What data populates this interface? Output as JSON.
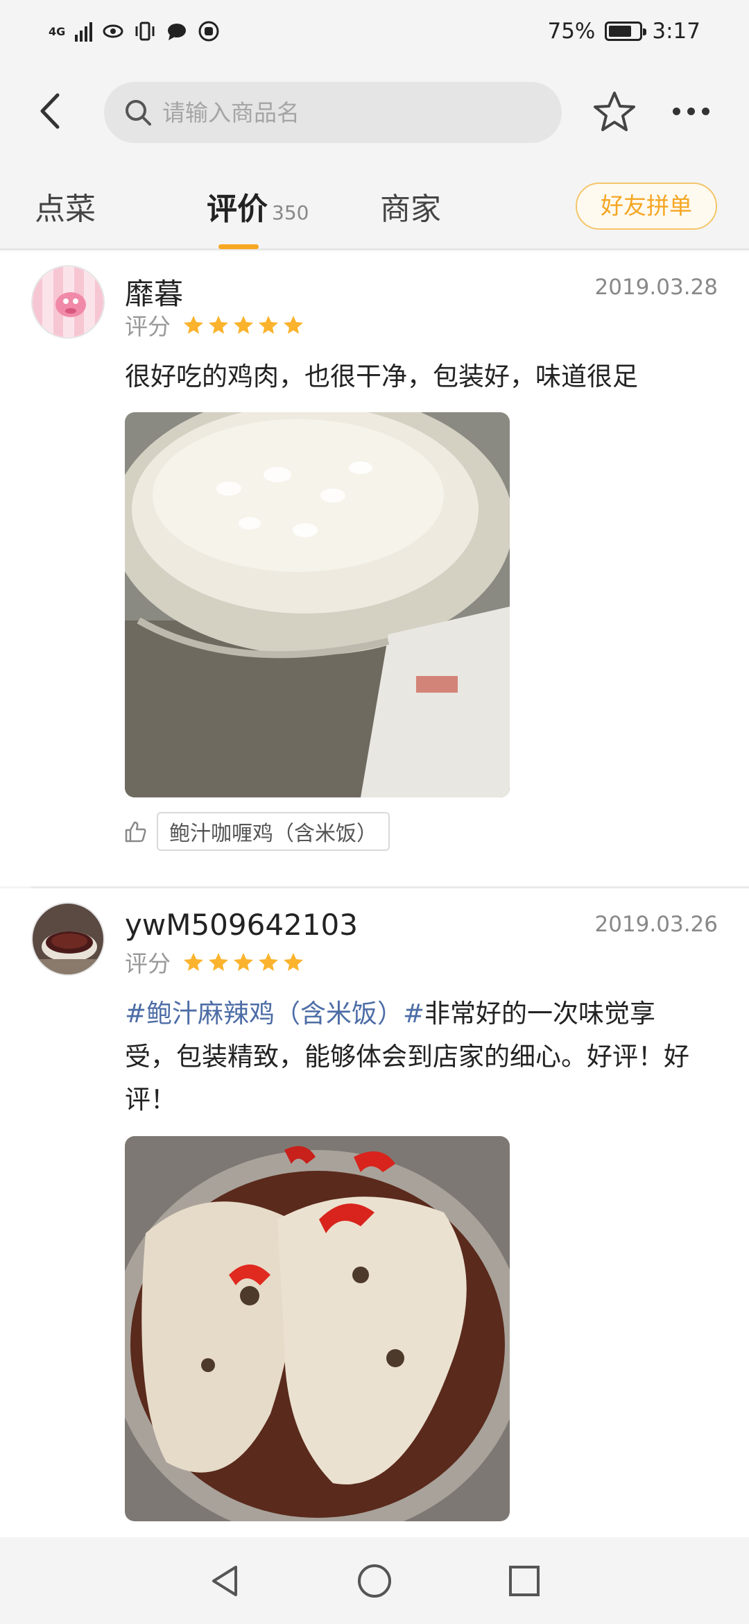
{
  "status_bar": {
    "network": "4G",
    "battery_percent": "75%",
    "battery_level": 0.75,
    "time": "3:17"
  },
  "search": {
    "placeholder": "请输入商品名"
  },
  "tabs": {
    "menu": "点菜",
    "reviews": "评价",
    "reviews_count": "350",
    "merchant": "商家",
    "active": "reviews"
  },
  "friend_order_button": "好友拼单",
  "reviews": [
    {
      "username": "靡暮",
      "date": "2019.03.28",
      "rating_label": "评分",
      "stars": 5,
      "text": "很好吃的鸡肉，也很干净，包装好，味道很足",
      "dish_tag": "鲍汁咖喱鸡（含米饭）"
    },
    {
      "username": "ywM509642103",
      "date": "2019.03.26",
      "rating_label": "评分",
      "stars": 5,
      "topic": "#鲍汁麻辣鸡（含米饭）#",
      "text": "非常好的一次味觉享受，包装精致，能够体会到店家的细心。好评！好评！"
    }
  ],
  "colors": {
    "accent": "#f7a823",
    "star": "#fbb32d",
    "topic": "#4d6da6",
    "friend_button_text": "#f5a623"
  },
  "icons": {
    "back": "chevron-left-icon",
    "search": "search-icon",
    "favorite": "star-outline-icon",
    "more": "more-dots-icon",
    "like": "thumbs-up-icon",
    "nav_back": "triangle-back-icon",
    "nav_home": "circle-home-icon",
    "nav_recents": "square-recents-icon"
  }
}
